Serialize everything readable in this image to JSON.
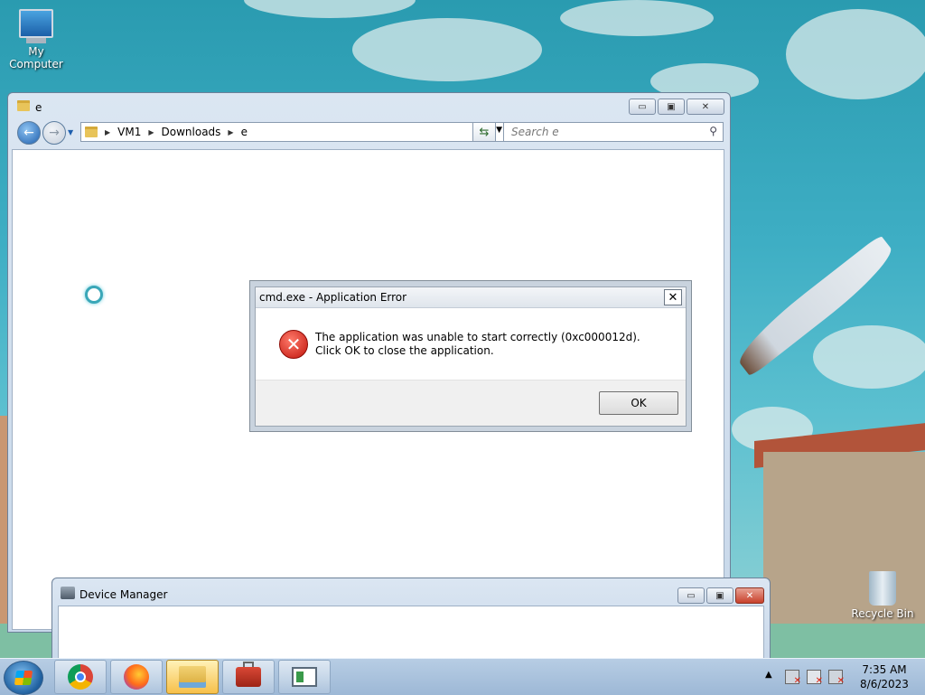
{
  "desktop": {
    "icons": [
      {
        "label": "My Computer",
        "icon": "computer-icon"
      },
      {
        "label": "Recycle Bin",
        "icon": "recycle-bin-icon"
      }
    ]
  },
  "explorer": {
    "title": "e",
    "breadcrumb": [
      "VM1",
      "Downloads",
      "e"
    ],
    "search_placeholder": "Search e",
    "buttons": {
      "minimize": "▭",
      "maximize": "▣",
      "close": "✕"
    }
  },
  "dialog": {
    "title": "cmd.exe - Application Error",
    "message": "The application was unable to start correctly (0xc000012d). Click OK to close the application.",
    "ok_label": "OK",
    "close_label": "✕",
    "error_glyph": "✕"
  },
  "device_manager": {
    "title": "Device Manager",
    "buttons": {
      "minimize": "▭",
      "maximize": "▣",
      "close": "✕"
    }
  },
  "taskbar": {
    "items": [
      "chrome-icon",
      "firefox-icon",
      "file-explorer-icon",
      "toolbox-icon",
      "device-manager-icon"
    ],
    "clock": {
      "time": "7:35 AM",
      "date": "8/6/2023"
    }
  }
}
